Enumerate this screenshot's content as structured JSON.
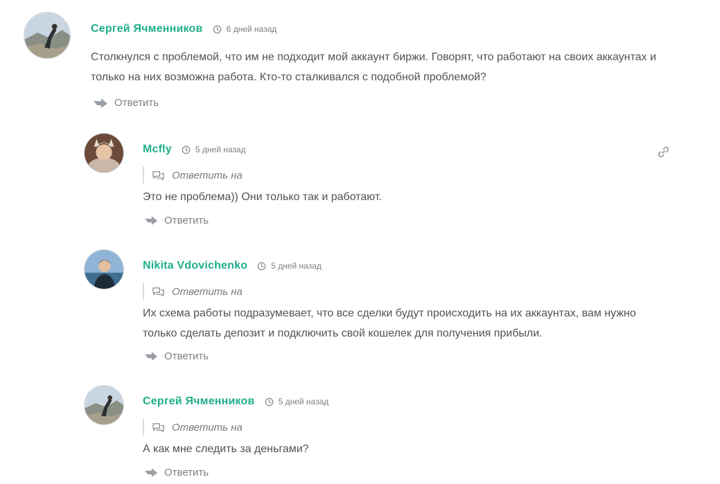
{
  "comments": [
    {
      "author": "Сергей Ячменников",
      "time": "6 дней назад",
      "text": "Столкнулся с проблемой, что им не подходит мой аккаунт биржи. Говорят, что работают на своих аккаунтах и только на них возможна работа. Кто-то сталкивался с подобной проблемой?",
      "reply_label": "Ответить"
    },
    {
      "author": "Mcfly",
      "time": "5 дней назад",
      "reply_to": "Ответить на",
      "text": "Это не проблема)) Они только так и работают.",
      "reply_label": "Ответить"
    },
    {
      "author": "Nikita Vdovichenko",
      "time": "5 дней назад",
      "reply_to": "Ответить на",
      "text": "Их схема работы подразумевает, что все сделки будут происходить на их аккаунтах, вам нужно только сделать депозит и подключить свой кошелек для получения прибыли.",
      "reply_label": "Ответить"
    },
    {
      "author": "Сергей Ячменников",
      "time": "5 дней назад",
      "reply_to": "Ответить на",
      "text": "А как мне следить за деньгами?",
      "reply_label": "Ответить"
    }
  ],
  "icons": {
    "clock": "clock-icon",
    "reply": "reply-arrow-icon",
    "reply_to": "speech-bubbles-icon",
    "permalink": "link-icon"
  },
  "colors": {
    "author": "#1fae8a",
    "meta": "#7b7f84",
    "text": "#4e5358"
  }
}
